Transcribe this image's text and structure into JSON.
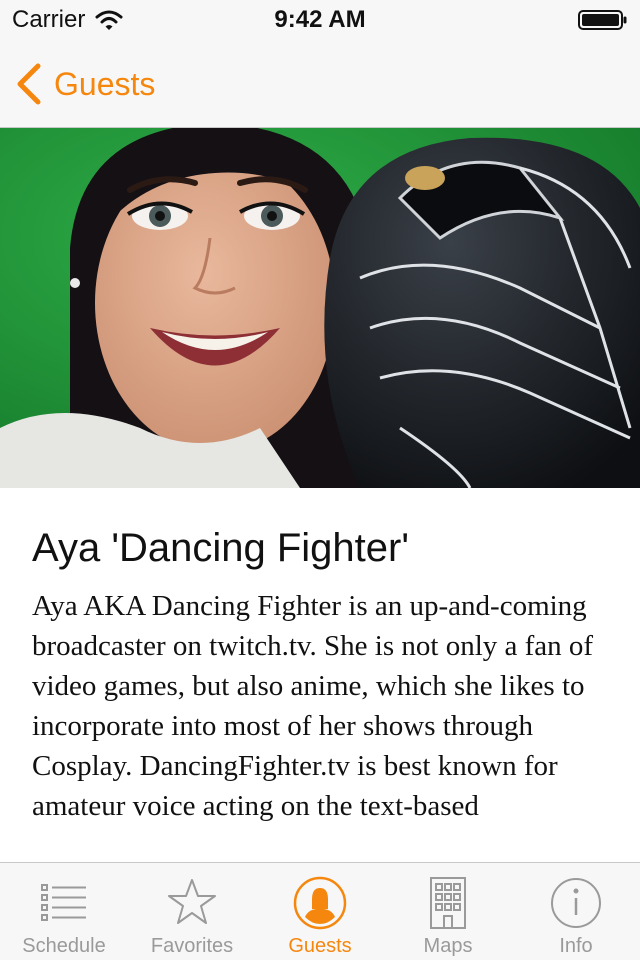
{
  "status_bar": {
    "carrier": "Carrier",
    "time": "9:42 AM"
  },
  "nav": {
    "back_label": "Guests",
    "accent_color": "#f5870f"
  },
  "hero": {
    "icon": "guest-photo"
  },
  "guest": {
    "name": "Aya 'Dancing Fighter'",
    "bio": "Aya AKA Dancing Fighter is an up-and-coming broadcaster on twitch.tv. She is not only a fan of video games, but also anime, which she likes to incorporate into most of her shows through Cosplay. DancingFighter.tv is best known for amateur voice acting on the text-based"
  },
  "tabs": [
    {
      "label": "Schedule",
      "icon": "list-icon",
      "active": false
    },
    {
      "label": "Favorites",
      "icon": "star-icon",
      "active": false
    },
    {
      "label": "Guests",
      "icon": "person-icon",
      "active": true
    },
    {
      "label": "Maps",
      "icon": "building-icon",
      "active": false
    },
    {
      "label": "Info",
      "icon": "info-icon",
      "active": false
    }
  ]
}
